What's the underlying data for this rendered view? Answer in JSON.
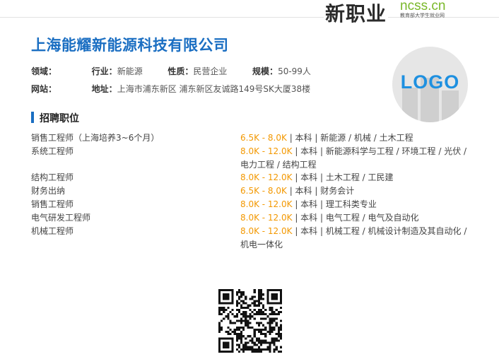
{
  "brand": {
    "script_text": "新职业",
    "site_text": "ncss.cn",
    "subtitle": "教育部大学生就业网"
  },
  "company": {
    "name": "上海能耀新能源科技有限公司",
    "fields": {
      "domain_label": "领域：",
      "domain_value": "",
      "industry_label": "行业：",
      "industry_value": "新能源",
      "nature_label": "性质：",
      "nature_value": "民营企业",
      "size_label": "规模：",
      "size_value": "50-99人",
      "website_label": "网站：",
      "website_value": "",
      "address_label": "地址：",
      "address_value": "上海市浦东新区 浦东新区友诚路149号SK大厦38楼"
    },
    "logo_text": "LOGO"
  },
  "section": {
    "title": "招聘职位"
  },
  "jobs": [
    {
      "title": "销售工程师（上海培养3~6个月）",
      "salary": "6.5K - 8.0K",
      "details": " | 本科 | 新能源 / 机械 / 土木工程"
    },
    {
      "title": "系统工程师",
      "salary": "8.0K - 12.0K",
      "details": " | 本科 | 新能源科学与工程 / 环境工程 / 光伏 / 电力工程 / 结构工程"
    },
    {
      "title": "结构工程师",
      "salary": "8.0K - 12.0K",
      "details": " | 本科 | 土木工程 / 工民建"
    },
    {
      "title": "财务出纳",
      "salary": "6.5K - 8.0K",
      "details": " | 本科 | 财务会计"
    },
    {
      "title": "销售工程师",
      "salary": "8.0K - 12.0K",
      "details": " | 本科 | 理工科类专业"
    },
    {
      "title": "电气研发工程师",
      "salary": "8.0K - 12.0K",
      "details": " | 本科 | 电气工程 / 电气及自动化"
    },
    {
      "title": "机械工程师",
      "salary": "8.0K - 12.0K",
      "details": " | 本科 | 机械工程 / 机械设计制造及其自动化 / 机电一体化"
    }
  ],
  "qr": {
    "icon": "qr-code-icon"
  },
  "colors": {
    "title_blue": "#1a6ec2",
    "salary_orange": "#f39800",
    "brand_green": "#7ab82a"
  }
}
